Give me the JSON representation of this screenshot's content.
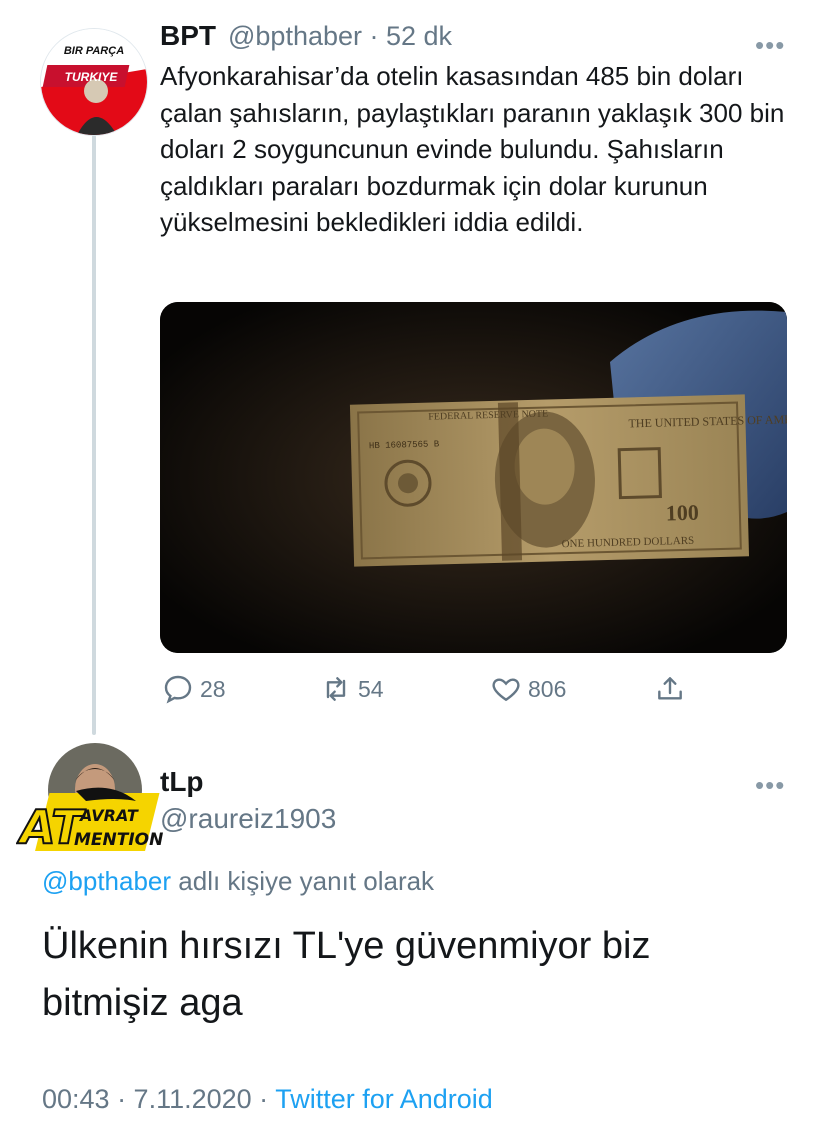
{
  "parent_tweet": {
    "display_name": "BPT",
    "handle_time": "@bpthaber · 52 dk",
    "avatar_text_top": "BIR PARÇA",
    "avatar_text_bottom": "TURKIYE",
    "text": "Afyonkarahisar’da otelin kasasından 485 bin doları çalan şahısların, paylaştıkları paranın yaklaşık 300 bin doları 2 soyguncunun evinde bulundu. Şahısların çaldıkları paraları bozdurmak için dolar kurunun yükselmesini bekledikleri iddia edildi.",
    "media": {
      "note_top": "FEDERAL RESERVE NOTE",
      "note_country": "THE UNITED STATES OF AMERICA",
      "serial": "HB 16087565 B",
      "denomination": "100",
      "note_bottom": "ONE HUNDRED DOLLARS"
    },
    "actions": {
      "reply_icon": "reply-icon",
      "reply_count": "28",
      "retweet_icon": "retweet-icon",
      "retweet_count": "54",
      "like_icon": "heart-icon",
      "like_count": "806",
      "share_icon": "share-icon"
    },
    "more_icon": "more-icon"
  },
  "reply_tweet": {
    "display_name": "tLp",
    "handle": "@raureiz1903",
    "badge_big": "AT",
    "badge_line1": "AVRAT",
    "badge_line2": "MENTION",
    "replying_mention": "@bpthaber",
    "replying_suffix": " adlı kişiye yanıt olarak",
    "text": "Ülkenin hırsızı TL'ye güvenmiyor biz bitmişiz aga",
    "time": "00:43 · 7.11.2020 · ",
    "source": "Twitter for Android",
    "more_icon": "more-icon"
  },
  "colors": {
    "accent": "#1da1f2",
    "secondary_text": "#657786",
    "primary_text": "#14171a"
  }
}
